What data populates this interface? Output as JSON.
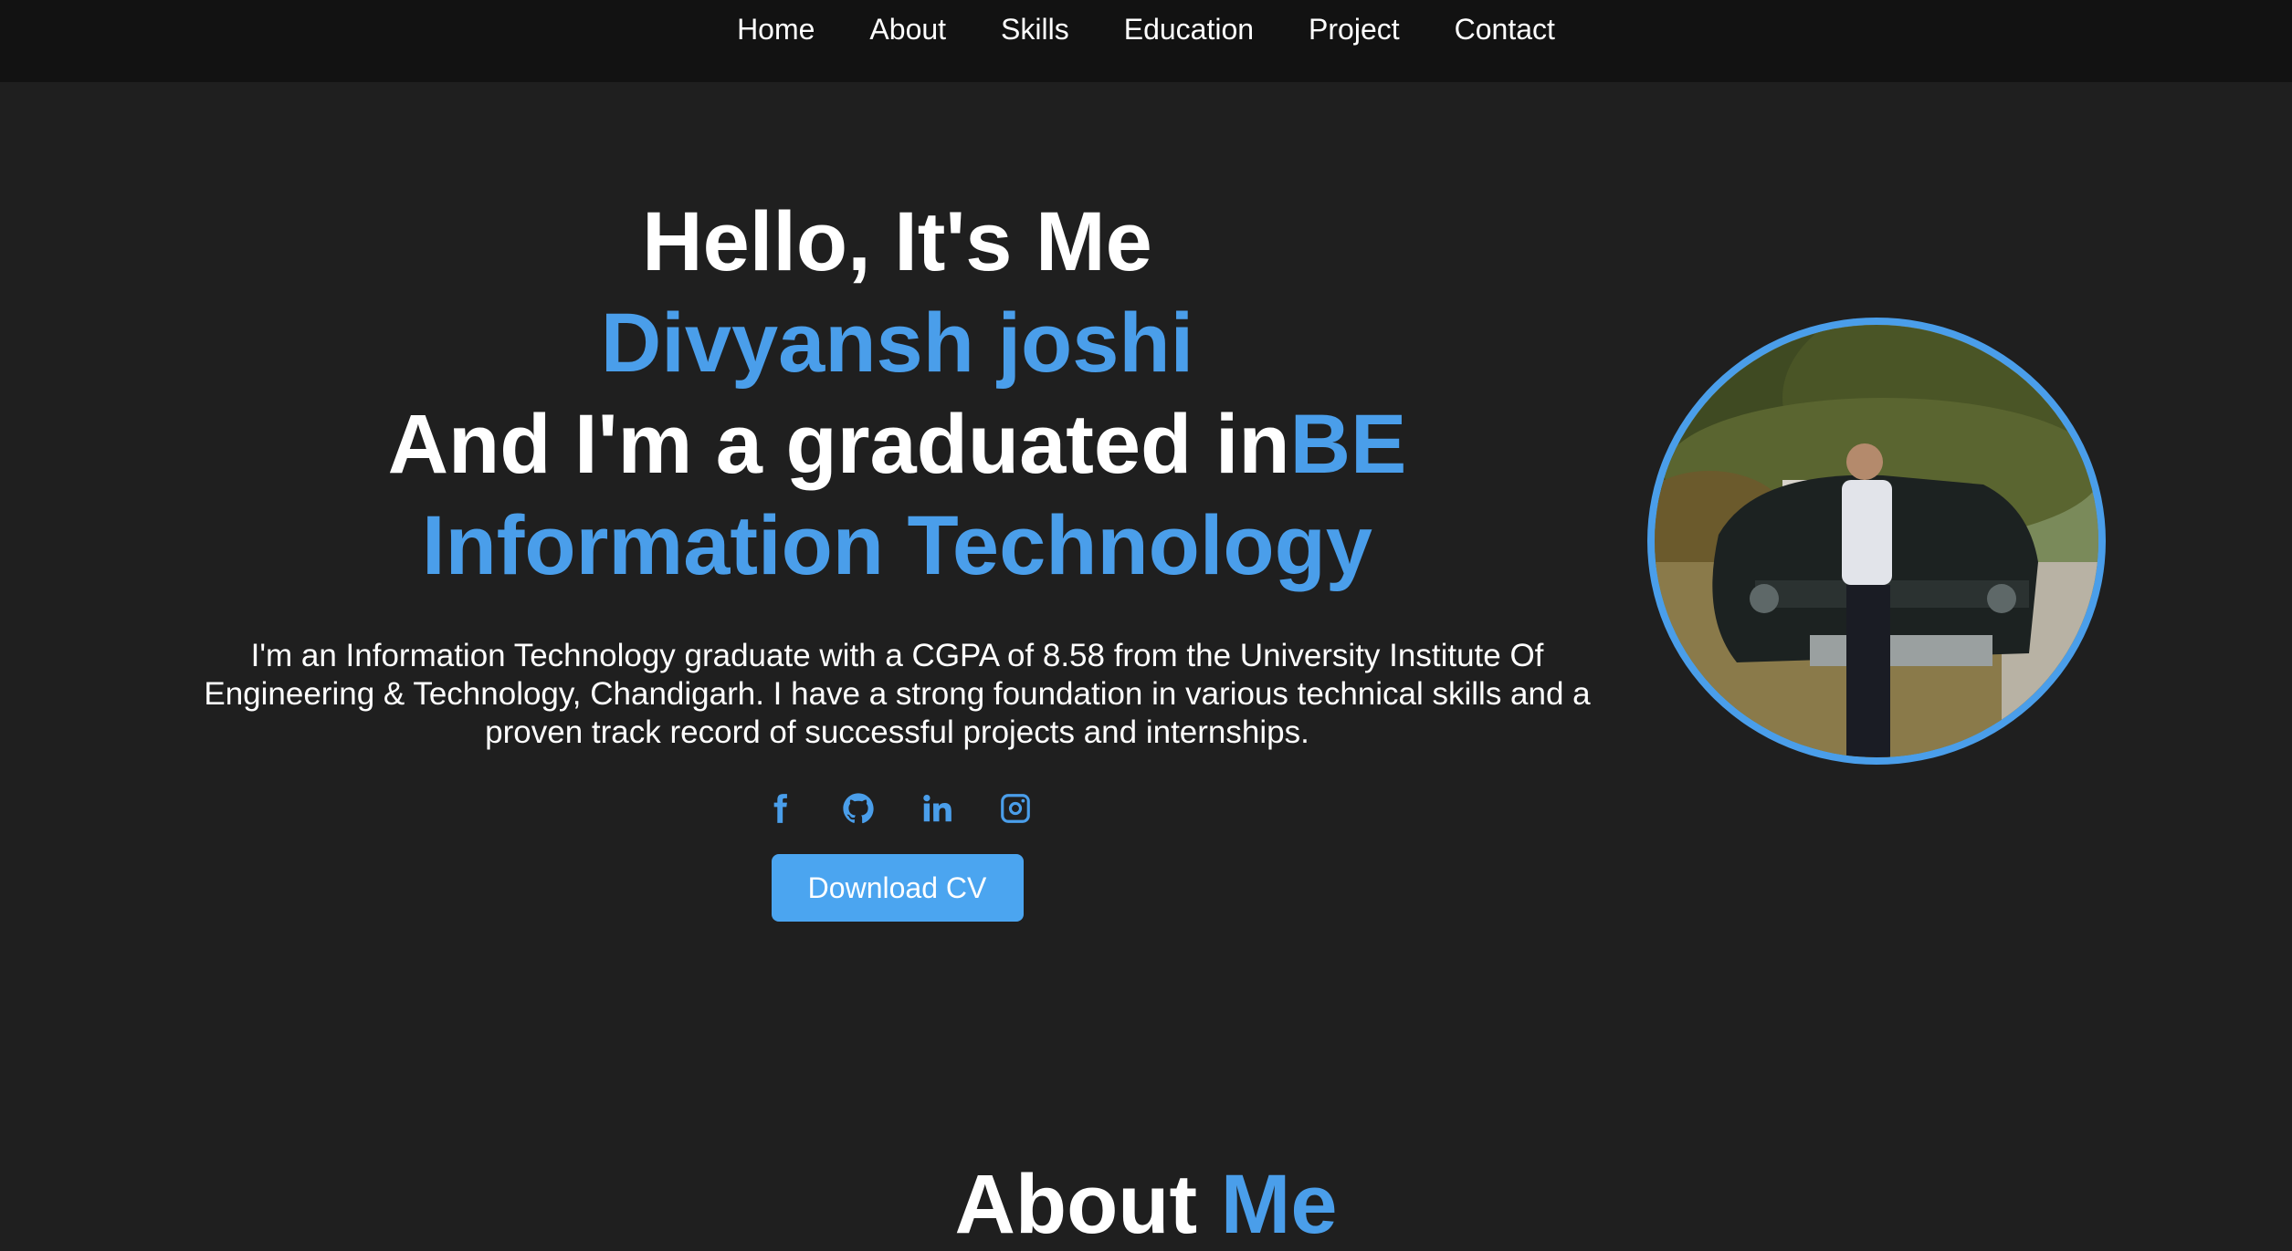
{
  "nav": {
    "items": [
      {
        "label": "Home"
      },
      {
        "label": "About"
      },
      {
        "label": "Skills"
      },
      {
        "label": "Education"
      },
      {
        "label": "Project"
      },
      {
        "label": "Contact"
      }
    ]
  },
  "hero": {
    "greeting": "Hello, It's Me",
    "name": "Divyansh joshi",
    "role_prefix": "And I'm a graduated in",
    "degree": "BE",
    "field": "Information Technology",
    "bio": "I'm an Information Technology graduate with a CGPA of 8.58 from the University Institute Of Engineering & Technology, Chandigarh. I have a strong foundation in various technical skills and a proven track record of successful projects and internships.",
    "socials": [
      {
        "icon": "facebook-icon"
      },
      {
        "icon": "github-icon"
      },
      {
        "icon": "linkedin-icon"
      },
      {
        "icon": "instagram-icon"
      }
    ],
    "cv_label": "Download CV"
  },
  "about": {
    "title_prefix": "About",
    "title_accent": "Me"
  },
  "colors": {
    "background": "#1f1f1f",
    "navbar": "#121212",
    "accent": "#4a9eea",
    "button": "#4ba5f0"
  }
}
